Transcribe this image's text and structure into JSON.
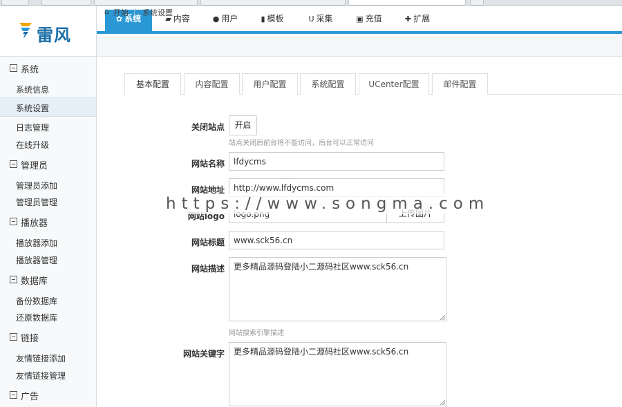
{
  "brand": {
    "name": "雷风"
  },
  "nav": {
    "tabs": [
      {
        "label": "系统",
        "icon": "gear-icon"
      },
      {
        "label": "内容",
        "icon": "book-icon"
      },
      {
        "label": "用户",
        "icon": "user-icon"
      },
      {
        "label": "模板",
        "icon": "file-icon"
      },
      {
        "label": "采集",
        "icon": "magnet-icon"
      },
      {
        "label": "充值",
        "icon": "money-icon"
      },
      {
        "label": "扩展",
        "icon": "puzzle-icon"
      }
    ]
  },
  "breadcrumb": {
    "home": "开始",
    "current": "系统设置"
  },
  "sidebar": {
    "groups": [
      {
        "label": "系统",
        "items": [
          "系统信息",
          "系统设置",
          "日志管理",
          "在线升级"
        ]
      },
      {
        "label": "管理员",
        "items": [
          "管理员添加",
          "管理员管理"
        ]
      },
      {
        "label": "播放器",
        "items": [
          "播放器添加",
          "播放器管理"
        ]
      },
      {
        "label": "数据库",
        "items": [
          "备份数据库",
          "还原数据库"
        ]
      },
      {
        "label": "链接",
        "items": [
          "友情链接添加",
          "友情链接管理"
        ]
      },
      {
        "label": "广告",
        "items": []
      }
    ],
    "active_item": "系统设置"
  },
  "subtabs": [
    "基本配置",
    "内容配置",
    "用户配置",
    "系统配置",
    "UCenter配置",
    "邮件配置"
  ],
  "form": {
    "close_site": {
      "label": "关闭站点",
      "button": "开启",
      "hint": "站点关闭后前台将不能访问，后台可以正常访问"
    },
    "site_name": {
      "label": "网站名称",
      "value": "lfdycms"
    },
    "site_url": {
      "label": "网站地址",
      "value": "http://www.lfdycms.com"
    },
    "site_logo": {
      "label": "网站logo",
      "value": "logo.png",
      "upload_button": "上传图片"
    },
    "site_title": {
      "label": "网站标题",
      "value": "www.sck56.cn"
    },
    "site_description": {
      "label": "网站描述",
      "value": "更多精品源码登陆小二源码社区www.sck56.cn",
      "hint": "网站搜索引擎描述"
    },
    "site_keywords": {
      "label": "网站关键字",
      "value": "更多精品源码登陆小二源码社区www.sck56.cn"
    }
  },
  "watermark": "https://www.songma.com",
  "colors": {
    "accent": "#2b98d6",
    "brand": "#1a6ea8"
  }
}
